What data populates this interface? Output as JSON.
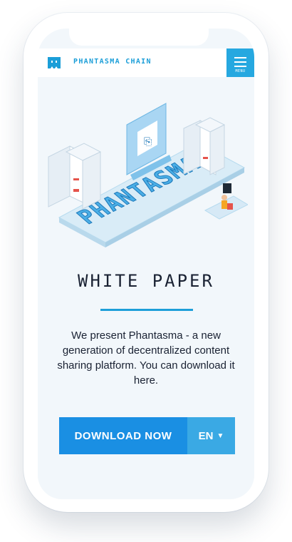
{
  "header": {
    "brand": "PHANTASMA CHAIN",
    "menu_label": "MENU"
  },
  "illustration": {
    "word": "PHANTASMA"
  },
  "main": {
    "title": "WHITE PAPER",
    "description": "We present Phantasma - a new generation of decentralized content sharing platform. You can download it here.",
    "download_label": "DOWNLOAD NOW",
    "language": "EN"
  },
  "colors": {
    "accent": "#1a8fe3",
    "accent_light": "#3aa9e4",
    "brand": "#1b9ed8",
    "background": "#f2f7fb"
  }
}
